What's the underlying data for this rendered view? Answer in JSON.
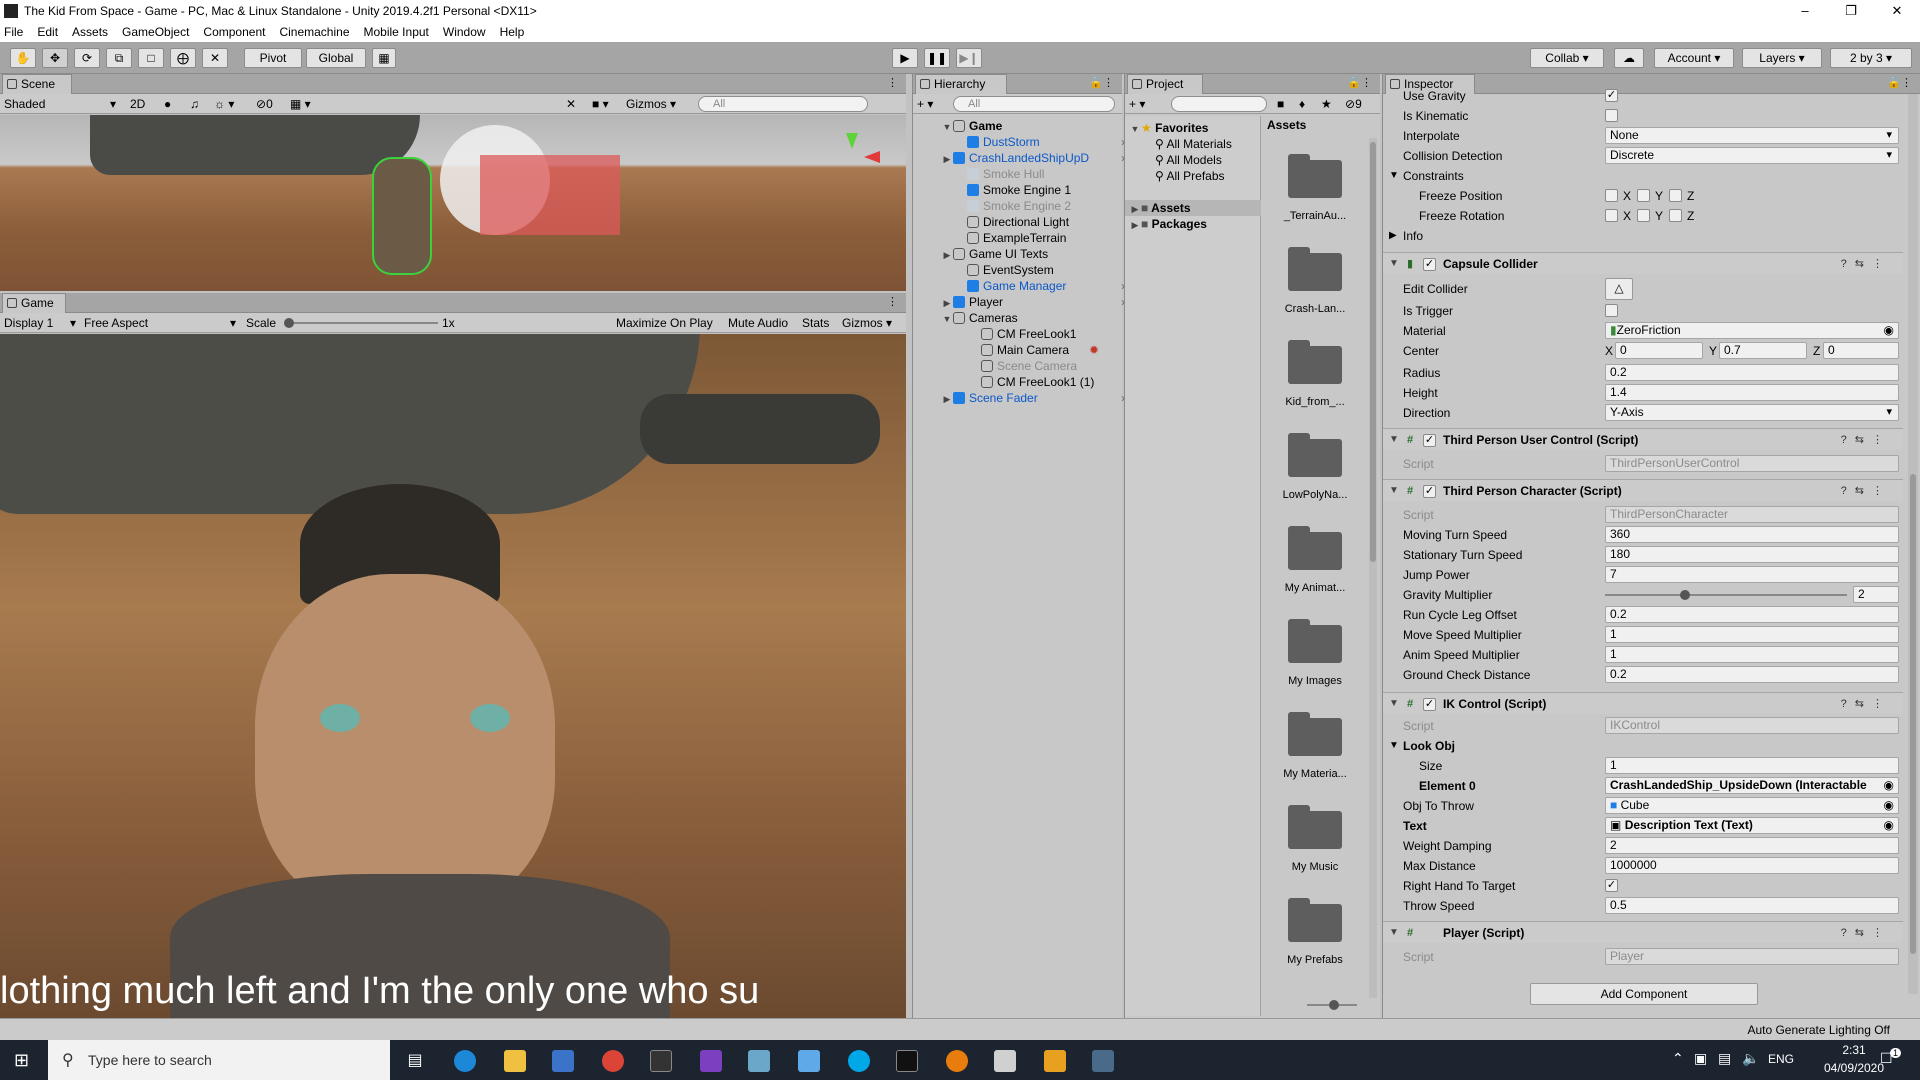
{
  "window": {
    "title": "The Kid From Space - Game - PC, Mac & Linux Standalone - Unity 2019.4.2f1 Personal <DX11>",
    "controls": [
      "–",
      "❐",
      "✕"
    ]
  },
  "menu": [
    "File",
    "Edit",
    "Assets",
    "GameObject",
    "Component",
    "Cinemachine",
    "Mobile Input",
    "Window",
    "Help"
  ],
  "toolbar": {
    "pivot": "Pivot",
    "global": "Global",
    "collab": "Collab",
    "account": "Account",
    "layers": "Layers",
    "layout": "2 by 3"
  },
  "scene": {
    "tab": "Scene",
    "shading": "Shaded",
    "mode2d": "2D",
    "hidden_count": "0",
    "gizmos": "Gizmos",
    "search_placeholder": "All"
  },
  "game": {
    "tab": "Game",
    "display": "Display 1",
    "aspect": "Free Aspect",
    "scale_label": "Scale",
    "scale_value": "1x",
    "maximize": "Maximize On Play",
    "mute": "Mute Audio",
    "stats": "Stats",
    "gizmos": "Gizmos",
    "subtitle": "lothing much left and I'm the only one who su"
  },
  "hierarchy": {
    "tab": "Hierarchy",
    "search_placeholder": "All",
    "root": "Game",
    "items": [
      {
        "label": "DustStorm",
        "color": "#0b58c9",
        "icon": "blue"
      },
      {
        "label": "CrashLandedShipUpD",
        "color": "#0b58c9",
        "icon": "blue"
      },
      {
        "label": "Smoke Hull",
        "color": "#8a8a8a",
        "icon": "faint"
      },
      {
        "label": "Smoke Engine 1",
        "color": "#000000",
        "icon": "blue"
      },
      {
        "label": "Smoke Engine 2",
        "color": "#8a8a8a",
        "icon": "faint"
      },
      {
        "label": "Directional Light",
        "color": "#000000",
        "icon": "empty"
      },
      {
        "label": "ExampleTerrain",
        "color": "#000000",
        "icon": "empty"
      },
      {
        "label": "Game UI Texts",
        "color": "#000000",
        "icon": "empty"
      },
      {
        "label": "EventSystem",
        "color": "#000000",
        "icon": "empty"
      },
      {
        "label": "Game Manager",
        "color": "#0b58c9",
        "icon": "blue"
      },
      {
        "label": "Player",
        "color": "#000000",
        "icon": "blue"
      },
      {
        "label": "Cameras",
        "color": "#000000",
        "icon": "empty"
      },
      {
        "label": "CM FreeLook1",
        "color": "#000000",
        "icon": "empty"
      },
      {
        "label": "Main Camera",
        "color": "#000000",
        "icon": "empty"
      },
      {
        "label": "Scene Camera",
        "color": "#8a8a8a",
        "icon": "empty"
      },
      {
        "label": "CM FreeLook1 (1)",
        "color": "#000000",
        "icon": "empty"
      },
      {
        "label": "Scene Fader",
        "color": "#0b58c9",
        "icon": "blue"
      }
    ]
  },
  "project": {
    "tab": "Project",
    "hidden_count": "9",
    "favorites": "Favorites",
    "fav_items": [
      "All Materials",
      "All Models",
      "All Prefabs"
    ],
    "assets": "Assets",
    "packages": "Packages",
    "breadcrumb": "Assets",
    "folders": [
      "_TerrainAu...",
      "Crash-Lan...",
      "Kid_from_...",
      "LowPolyNa...",
      "My Animat...",
      "My Images",
      "My Materia...",
      "My Music",
      "My Prefabs"
    ]
  },
  "inspector": {
    "tab": "Inspector",
    "use_gravity": "Use Gravity",
    "is_kinematic": "Is Kinematic",
    "interpolate": {
      "label": "Interpolate",
      "value": "None"
    },
    "collision": {
      "label": "Collision Detection",
      "value": "Discrete"
    },
    "constraints": "Constraints",
    "freeze_pos": "Freeze Position",
    "freeze_rot": "Freeze Rotation",
    "axis_x": "X",
    "axis_y": "Y",
    "axis_z": "Z",
    "info": "Info",
    "capsule": {
      "title": "Capsule Collider",
      "edit_collider": "Edit Collider",
      "is_trigger": "Is Trigger",
      "material_label": "Material",
      "material": "ZeroFriction",
      "center_label": "Center",
      "center_x": "0",
      "center_y": "0.7",
      "center_z": "0",
      "radius_label": "Radius",
      "radius": "0.2",
      "height_label": "Height",
      "height": "1.4",
      "direction_label": "Direction",
      "direction": "Y-Axis"
    },
    "tpuc": {
      "title": "Third Person User Control (Script)",
      "script_label": "Script",
      "script": "ThirdPersonUserControl"
    },
    "tpc": {
      "title": "Third Person Character (Script)",
      "script_label": "Script",
      "script": "ThirdPersonCharacter",
      "fields": [
        {
          "label": "Moving Turn Speed",
          "value": "360"
        },
        {
          "label": "Stationary Turn Speed",
          "value": "180"
        },
        {
          "label": "Jump Power",
          "value": "7"
        },
        {
          "label": "Gravity Multiplier",
          "value": "2"
        },
        {
          "label": "Run Cycle Leg Offset",
          "value": "0.2"
        },
        {
          "label": "Move Speed Multiplier",
          "value": "1"
        },
        {
          "label": "Anim Speed Multiplier",
          "value": "1"
        },
        {
          "label": "Ground Check Distance",
          "value": "0.2"
        }
      ],
      "gravity_slider_fraction": 0.33
    },
    "ik": {
      "title": "IK Control (Script)",
      "script_label": "Script",
      "script": "IKControl",
      "look_obj": "Look Obj",
      "size_label": "Size",
      "size": "1",
      "element0_label": "Element 0",
      "element0": "CrashLandedShip_UpsideDown (Interactable",
      "obj_throw_label": "Obj To Throw",
      "obj_throw": "Cube",
      "text_label": "Text",
      "text": "Description Text (Text)",
      "weight_label": "Weight Damping",
      "weight": "2",
      "maxdist_label": "Max Distance",
      "maxdist": "1000000",
      "rht_label": "Right Hand To Target",
      "throw_label": "Throw Speed",
      "throw": "0.5"
    },
    "player": {
      "title": "Player (Script)",
      "script_label": "Script",
      "script": "Player"
    },
    "add_component": "Add Component"
  },
  "status": {
    "lighting": "Auto Generate Lighting Off"
  },
  "taskbar": {
    "search_placeholder": "Type here to search",
    "lang": "ENG",
    "time": "2:31",
    "date": "04/09/2020",
    "notifications": "1"
  }
}
